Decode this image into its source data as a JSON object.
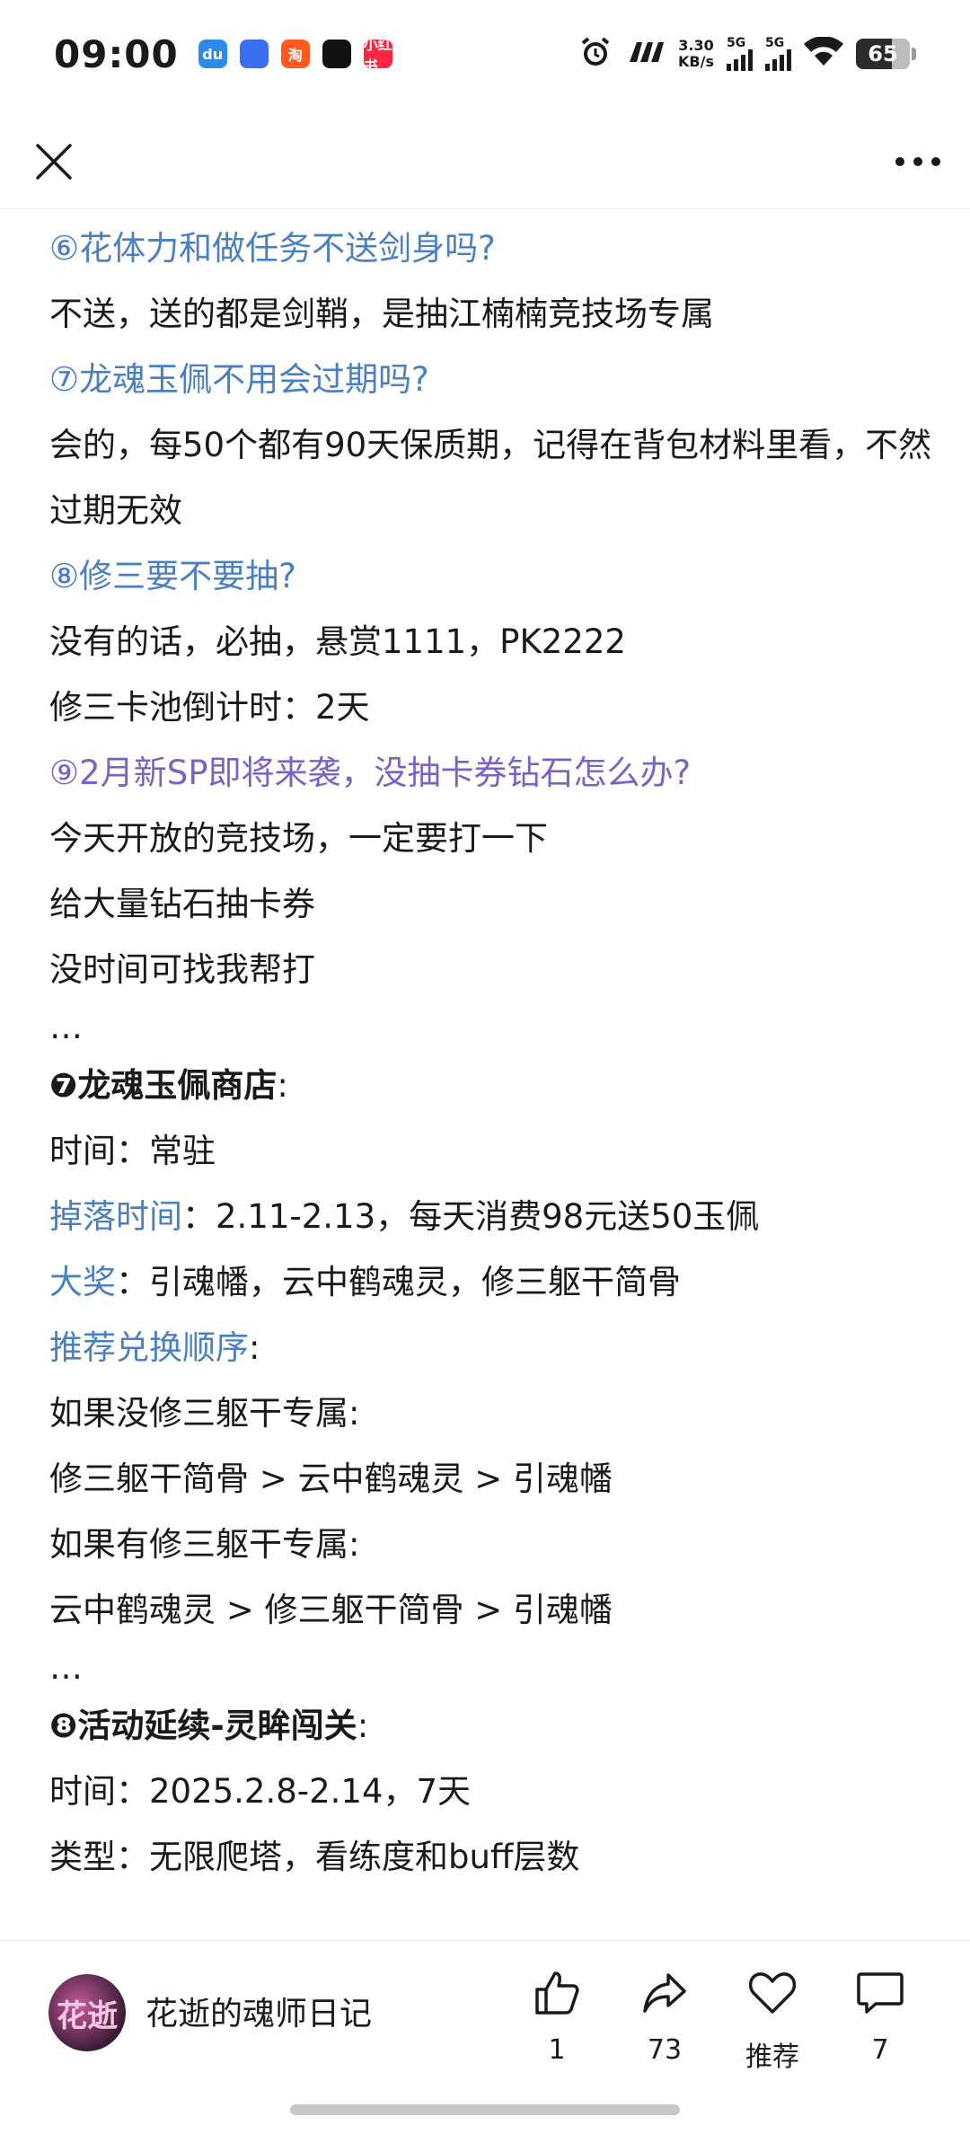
{
  "status_bar": {
    "time": "09:00",
    "app_icons": [
      {
        "name": "du-app-icon",
        "color": "#2b8be8",
        "text": "du"
      },
      {
        "name": "browser-app-icon",
        "color": "#3a6df0",
        "text": ""
      },
      {
        "name": "taobao-app-icon",
        "color": "#ff5a1f",
        "text": "淘"
      },
      {
        "name": "capcut-app-icon",
        "color": "#111111",
        "text": ""
      },
      {
        "name": "xiaohongshu-app-icon",
        "color": "#ff2442",
        "text": "小红书"
      }
    ],
    "net_speed_value": "3.30",
    "net_speed_unit": "KB/s",
    "signal1_label": "5G",
    "signal2_label": "5G",
    "battery": "65"
  },
  "content": {
    "lines": [
      {
        "text": "⑥花体力和做任务不送剑身吗?",
        "style": "q"
      },
      {
        "text": "不送，送的都是剑鞘，是抽江楠楠竞技场专属",
        "style": "plain"
      },
      {
        "text": "⑦龙魂玉佩不用会过期吗?",
        "style": "q"
      },
      {
        "text": "会的，每50个都有90天保质期，记得在背包材料里看，不然过期无效",
        "style": "plain-wrap"
      },
      {
        "text": "⑧修三要不要抽?",
        "style": "q"
      },
      {
        "text": "没有的话，必抽，悬赏1111，PK2222",
        "style": "plain"
      },
      {
        "text": "修三卡池倒计时：2天",
        "style": "plain"
      },
      {
        "text": "⑨2月新SP即将来袭，没抽卡券钻石怎么办?",
        "style": "q-purple"
      },
      {
        "text": "今天开放的竞技场，一定要打一下",
        "style": "plain"
      },
      {
        "text": "给大量钻石抽卡券",
        "style": "plain"
      },
      {
        "text": "没时间可找我帮打",
        "style": "plain"
      },
      {
        "text": "…",
        "style": "ellipsis"
      },
      {
        "text": "❼龙魂玉佩商店",
        "tail": ":",
        "style": "head"
      },
      {
        "text": "时间：常驻",
        "style": "plain"
      },
      {
        "text": "掉落时间",
        "tail": "：2.11-2.13，每天消费98元送50玉佩",
        "style": "key"
      },
      {
        "text": "大奖",
        "tail": "：引魂幡，云中鹤魂灵，修三躯干简骨",
        "style": "key"
      },
      {
        "text": "推荐兑换顺序",
        "tail": ":",
        "style": "key"
      },
      {
        "text": "如果没修三躯干专属:",
        "style": "plain"
      },
      {
        "text": "修三躯干简骨 > 云中鹤魂灵 > 引魂幡",
        "style": "plain"
      },
      {
        "text": "如果有修三躯干专属:",
        "style": "plain"
      },
      {
        "text": "云中鹤魂灵 > 修三躯干简骨 > 引魂幡",
        "style": "plain"
      },
      {
        "text": "…",
        "style": "ellipsis"
      },
      {
        "text": "❽活动延续-灵眸闯关",
        "tail": ":",
        "style": "head"
      },
      {
        "text": "时间：2025.2.8-2.14，7天",
        "style": "plain"
      },
      {
        "text": "类型：无限爬塔，看练度和buff层数",
        "style": "plain"
      }
    ]
  },
  "bottom_bar": {
    "avatar_text": "花逝",
    "author": "花逝的魂师日记",
    "like_count": "1",
    "share_count": "73",
    "recommend_label": "推荐",
    "comment_count": "7"
  },
  "colors": {
    "question_blue": "#4a7fc1",
    "question_purple": "#7b62c4",
    "text": "#1a1a1a"
  }
}
